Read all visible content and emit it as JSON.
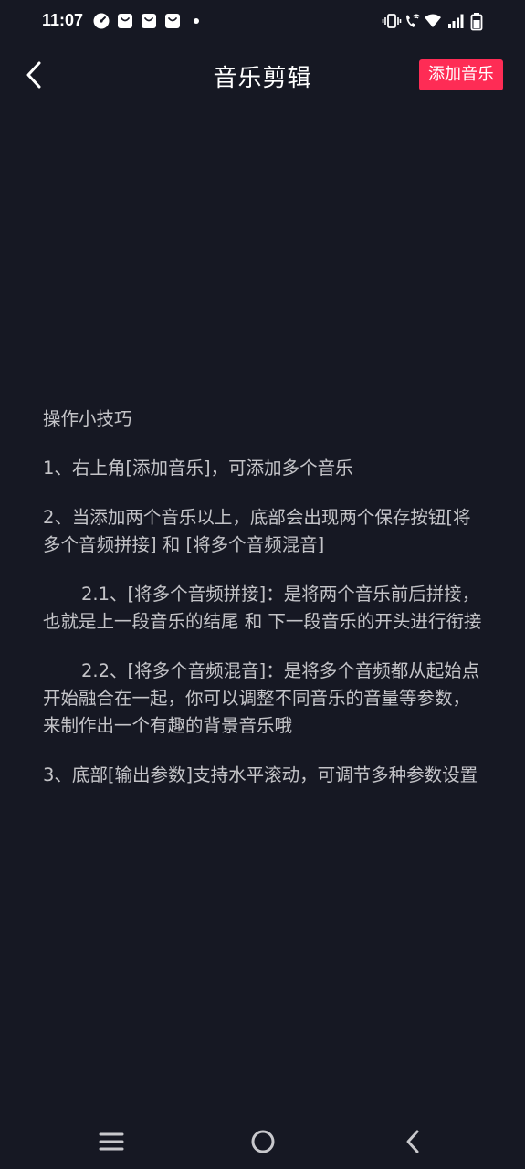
{
  "status_bar": {
    "time": "11:07",
    "left_icons": [
      "speedometer-icon",
      "shopping-bag-icon",
      "shopping-bag-icon",
      "shopping-bag-icon",
      "dot-icon"
    ],
    "right_icons": [
      "vibrate-icon",
      "wifi-calling-icon",
      "wifi-icon",
      "signal-icon",
      "battery-icon"
    ]
  },
  "app_bar": {
    "title": "音乐剪辑",
    "add_button_label": "添加音乐"
  },
  "tips": {
    "heading": "操作小技巧",
    "item1": "1、右上角[添加音乐]，可添加多个音乐",
    "item2": "2、当添加两个音乐以上，底部会出现两个保存按钮[将多个音频拼接] 和 [将多个音频混音]",
    "item2_1": "2.1、[将多个音频拼接]：是将两个音乐前后拼接，也就是上一段音乐的结尾 和 下一段音乐的开头进行衔接",
    "item2_2": "2.2、[将多个音频混音]：是将多个音频都从起始点开始融合在一起，你可以调整不同音乐的音量等参数，来制作出一个有趣的背景音乐哦",
    "item3": "3、底部[输出参数]支持水平滚动，可调节多种参数设置"
  },
  "nav_bar": {
    "icons": [
      "menu-icon",
      "home-icon",
      "back-icon"
    ]
  },
  "colors": {
    "background": "#161823",
    "accent": "#fe2c55",
    "tip_text": "#c4c4c8"
  }
}
